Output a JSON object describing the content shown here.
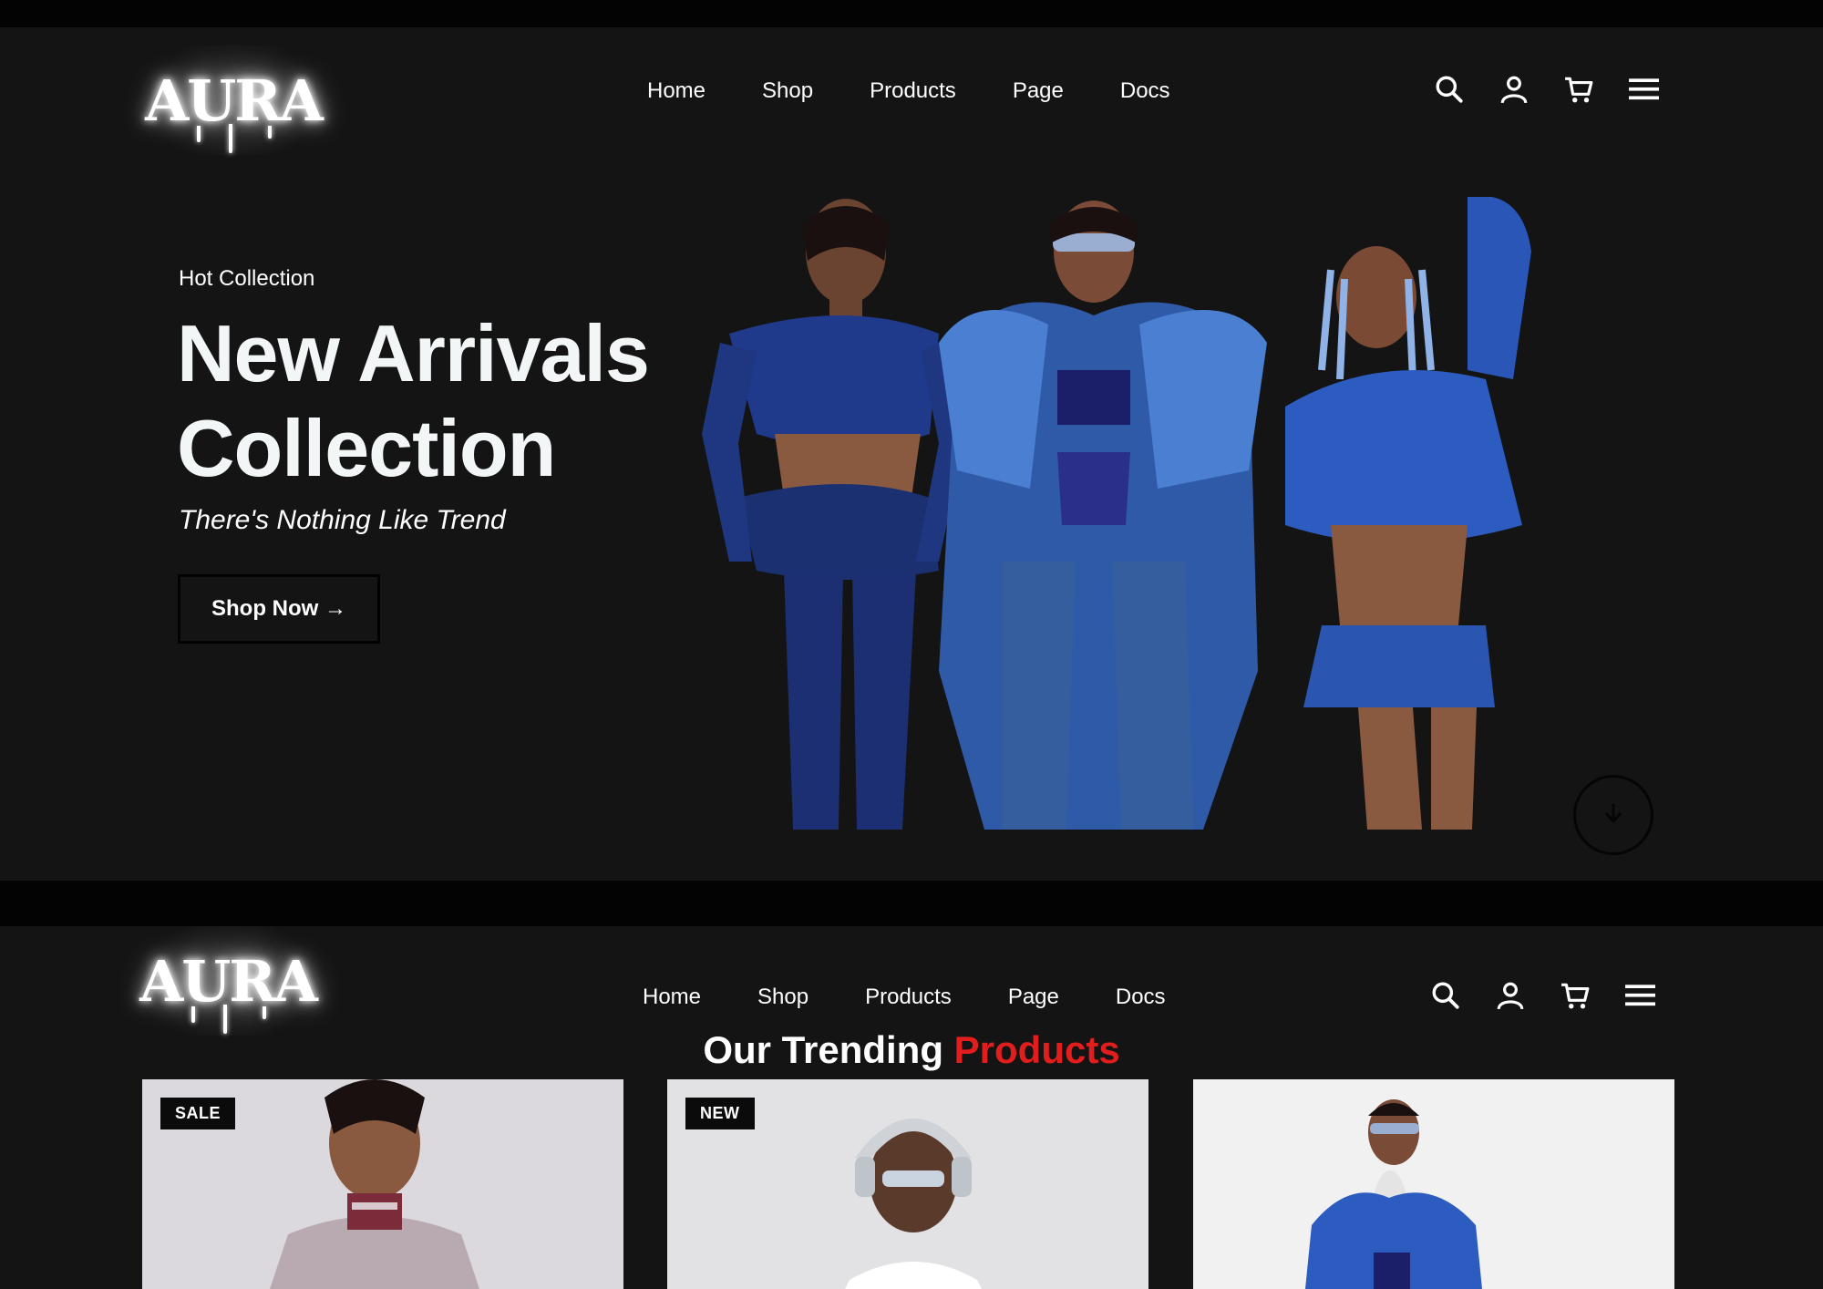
{
  "brand": {
    "logo_text": "AURA"
  },
  "nav": {
    "items": [
      "Home",
      "Shop",
      "Products",
      "Page",
      "Docs"
    ]
  },
  "header_icons": [
    "search-icon",
    "user-icon",
    "cart-icon",
    "menu-icon"
  ],
  "hero": {
    "eyebrow": "Hot Collection",
    "headline_line1": "New Arrivals",
    "headline_line2": "Collection",
    "tagline": "There's Nothing Like Trend",
    "cta_label": "Shop Now →"
  },
  "trending": {
    "title_part1": "Our Trending ",
    "title_part2": "Products",
    "products": [
      {
        "badge": "SALE"
      },
      {
        "badge": "NEW"
      },
      {
        "badge": ""
      }
    ]
  },
  "colors": {
    "background": "#141414",
    "outer": "#030303",
    "accent": "#e11d1d",
    "denim": "#1e3f8f",
    "text": "#ffffff"
  }
}
